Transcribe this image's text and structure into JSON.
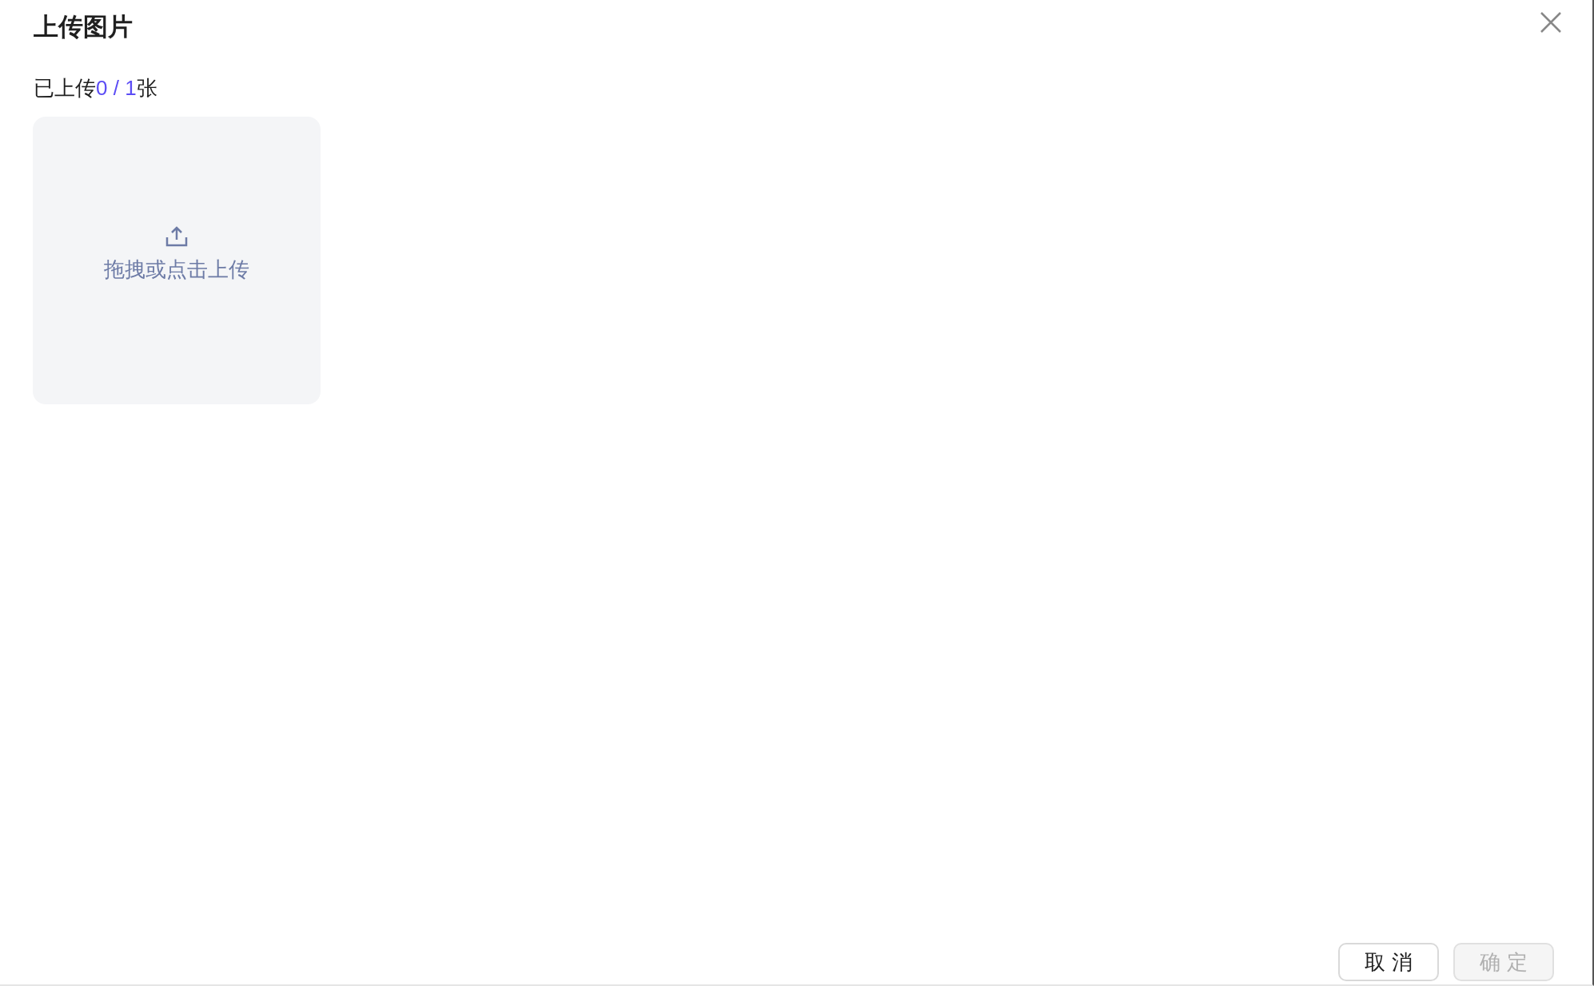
{
  "dialog": {
    "title": "上传图片"
  },
  "upload_count": {
    "prefix": "已上传",
    "count": "0 / 1",
    "suffix": "张"
  },
  "dropzone": {
    "label": "拖拽或点击上传"
  },
  "buttons": [
    {
      "label": "取 消",
      "disabled": false
    },
    {
      "label": "确 定",
      "disabled": true
    }
  ]
}
